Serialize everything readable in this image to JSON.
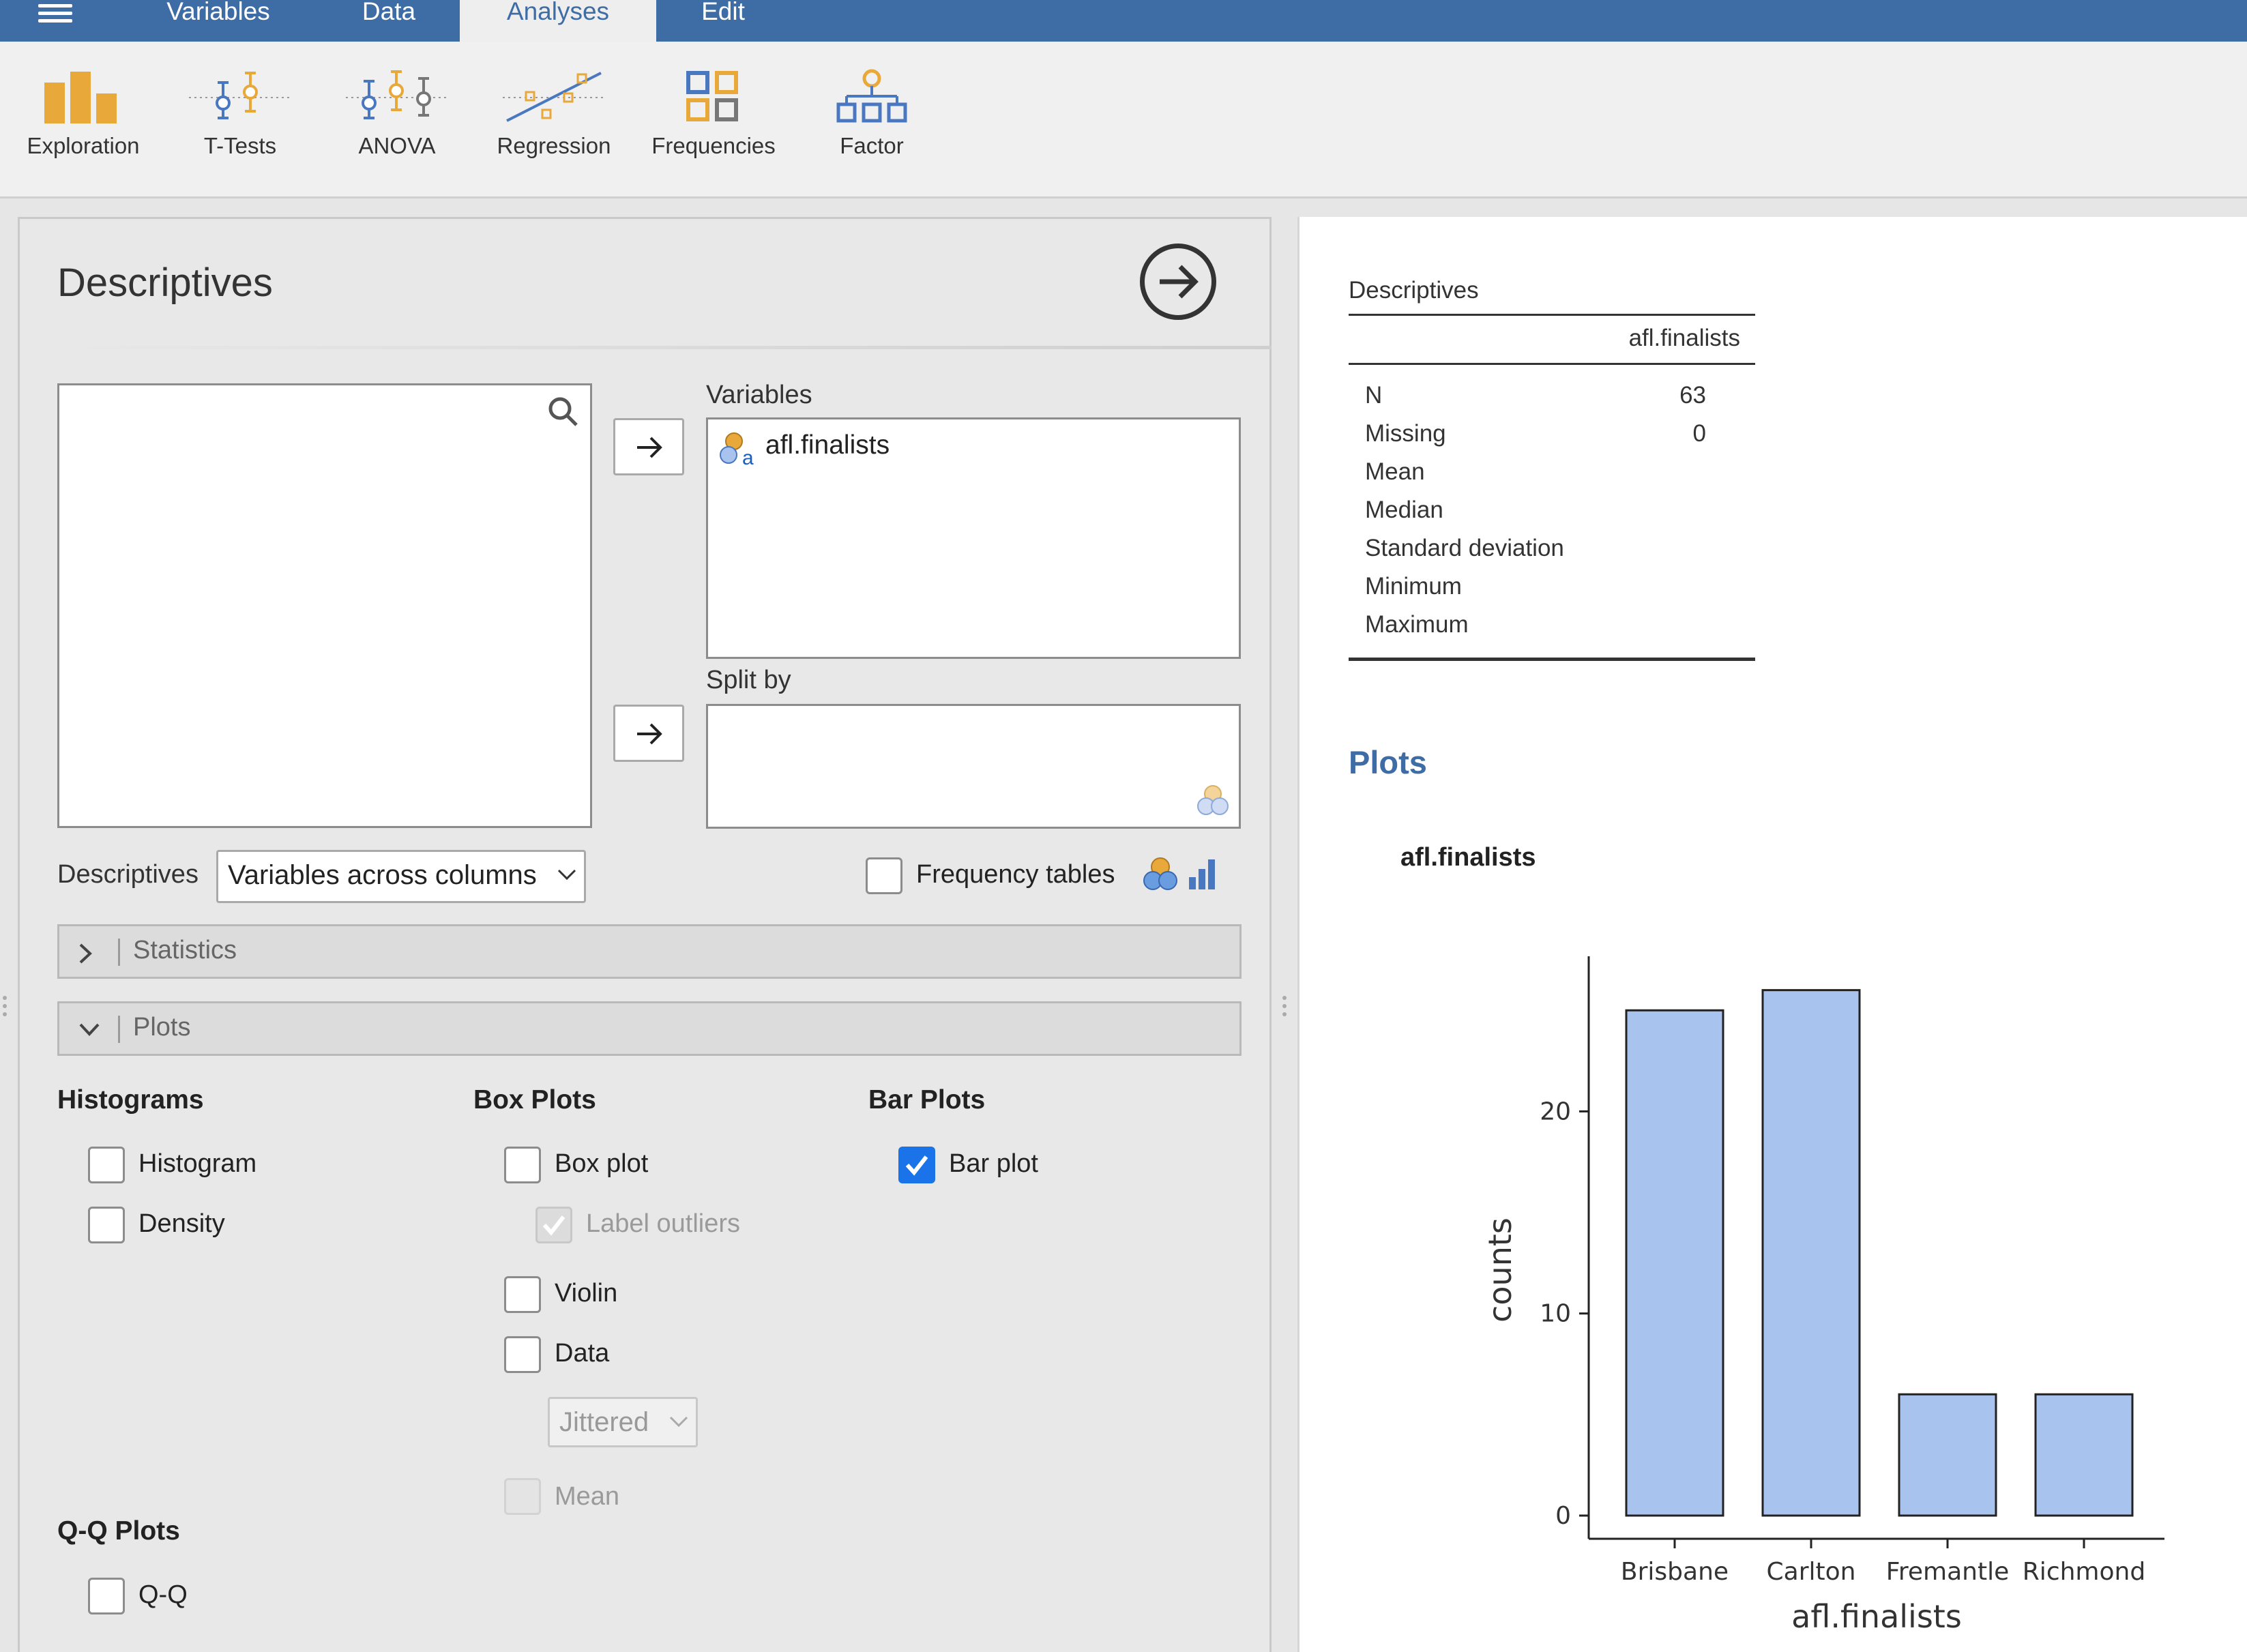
{
  "nav": {
    "tabs": [
      {
        "label": "Variables"
      },
      {
        "label": "Data"
      },
      {
        "label": "Analyses"
      },
      {
        "label": "Edit"
      }
    ]
  },
  "ribbon": {
    "buttons": [
      {
        "label": "Exploration",
        "icon": "exploration-bar-icon"
      },
      {
        "label": "T-Tests",
        "icon": "ttests-icon"
      },
      {
        "label": "ANOVA",
        "icon": "anova-icon"
      },
      {
        "label": "Regression",
        "icon": "regression-icon"
      },
      {
        "label": "Frequencies",
        "icon": "frequencies-grid-icon"
      },
      {
        "label": "Factor",
        "icon": "factor-tree-icon"
      }
    ]
  },
  "options": {
    "title": "Descriptives",
    "variables_label": "Variables",
    "variables": [
      {
        "name": "afl.finalists",
        "icon": "nominal-text-variable-icon"
      }
    ],
    "splitby_label": "Split by",
    "descriptives_label": "Descriptives",
    "descriptives_mode": "Variables across columns",
    "frequency_tables_label": "Frequency tables",
    "frequency_tables_checked": false,
    "statistics_section": "Statistics",
    "plots_section": "Plots",
    "histograms": {
      "heading": "Histograms",
      "histogram_label": "Histogram",
      "histogram_checked": false,
      "density_label": "Density",
      "density_checked": false
    },
    "qq": {
      "heading": "Q-Q Plots",
      "qq_label": "Q-Q",
      "qq_checked": false
    },
    "boxplots": {
      "heading": "Box Plots",
      "box_label": "Box plot",
      "box_checked": false,
      "label_outliers_label": "Label outliers",
      "label_outliers_checked": true,
      "label_outliers_disabled": true,
      "violin_label": "Violin",
      "violin_checked": false,
      "data_label": "Data",
      "data_checked": false,
      "jitter_mode": "Jittered",
      "mean_label": "Mean",
      "mean_checked": false,
      "mean_disabled": true
    },
    "barplots": {
      "heading": "Bar Plots",
      "bar_label": "Bar plot",
      "bar_checked": true
    }
  },
  "results": {
    "table_title": "Descriptives",
    "column": "afl.finalists",
    "rows": [
      {
        "label": "N",
        "value": "63"
      },
      {
        "label": "Missing",
        "value": "0"
      },
      {
        "label": "Mean",
        "value": ""
      },
      {
        "label": "Median",
        "value": ""
      },
      {
        "label": "Standard deviation",
        "value": ""
      },
      {
        "label": "Minimum",
        "value": ""
      },
      {
        "label": "Maximum",
        "value": ""
      }
    ],
    "plots_heading": "Plots",
    "plot_title": "afl.finalists"
  },
  "colors": {
    "accent": "#3e6da6",
    "bar_fill": "#a8c4ee",
    "checkbox_checked": "#1a73e8"
  },
  "chart_data": {
    "type": "bar",
    "categories": [
      "Brisbane",
      "Carlton",
      "Fremantle",
      "Richmond"
    ],
    "values": [
      25,
      26,
      6,
      6
    ],
    "title": "afl.finalists",
    "xlabel": "afl.finalists",
    "ylabel": "counts",
    "ylim": [
      0,
      27
    ],
    "yticks": [
      0,
      10,
      20
    ],
    "grid": false
  }
}
